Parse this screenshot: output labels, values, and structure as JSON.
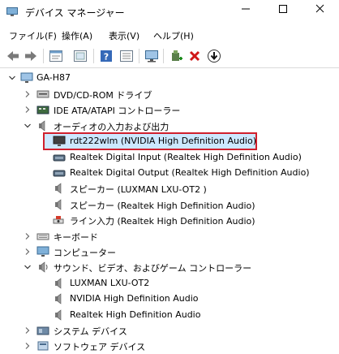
{
  "window": {
    "title": "デバイス マネージャー"
  },
  "menu": [
    "ファイル(F)",
    "操作(A)",
    "表示(V)",
    "ヘルプ(H)"
  ],
  "toolbar": {
    "icons": [
      "back-arrow-icon",
      "forward-arrow-icon",
      "properties-icon",
      "show-hidden-icon",
      "help-icon",
      "action-list-icon",
      "scan-monitor-icon",
      "add-driver-icon",
      "uninstall-x-icon",
      "update-driver-icon"
    ]
  },
  "tree": {
    "root": "GA-H87",
    "items": [
      {
        "label": "DVD/CD-ROM ドライブ",
        "state": "collapsed",
        "icon": "dvd-drive-icon"
      },
      {
        "label": "IDE ATA/ATAPI コントローラー",
        "state": "collapsed",
        "icon": "ide-controller-icon"
      },
      {
        "label": "オーディオの入力および出力",
        "state": "expanded",
        "icon": "speaker-icon"
      },
      {
        "label": "rdt222wlm (NVIDIA High Definition Audio)",
        "icon": "monitor-icon"
      },
      {
        "label": "Realtek Digital Input (Realtek High Definition Audio)",
        "icon": "digital-audio-icon"
      },
      {
        "label": "Realtek Digital Output (Realtek High Definition Audio)",
        "icon": "digital-audio-icon"
      },
      {
        "label": "スピーカー (LUXMAN LXU-OT2 )",
        "icon": "speaker-icon"
      },
      {
        "label": "スピーカー (Realtek High Definition Audio)",
        "icon": "speaker-icon"
      },
      {
        "label": "ライン入力 (Realtek High Definition Audio)",
        "icon": "line-in-icon",
        "selected": true
      },
      {
        "label": "キーボード",
        "state": "collapsed",
        "icon": "keyboard-icon"
      },
      {
        "label": "コンピューター",
        "state": "collapsed",
        "icon": "computer-icon"
      },
      {
        "label": "サウンド、ビデオ、およびゲーム コントローラー",
        "state": "expanded",
        "icon": "sound-video-icon"
      },
      {
        "label": "LUXMAN LXU-OT2",
        "icon": "speaker-icon"
      },
      {
        "label": "NVIDIA High Definition Audio",
        "icon": "speaker-icon"
      },
      {
        "label": "Realtek High Definition Audio",
        "icon": "speaker-icon"
      },
      {
        "label": "システム デバイス",
        "state": "collapsed",
        "icon": "system-device-icon"
      },
      {
        "label": "ソフトウェア デバイス",
        "state": "collapsed",
        "icon": "software-device-icon"
      }
    ]
  },
  "colors": {
    "accent": "#cce8ff",
    "highlight_border": "#d0202d",
    "selection": "#cce8ff"
  }
}
